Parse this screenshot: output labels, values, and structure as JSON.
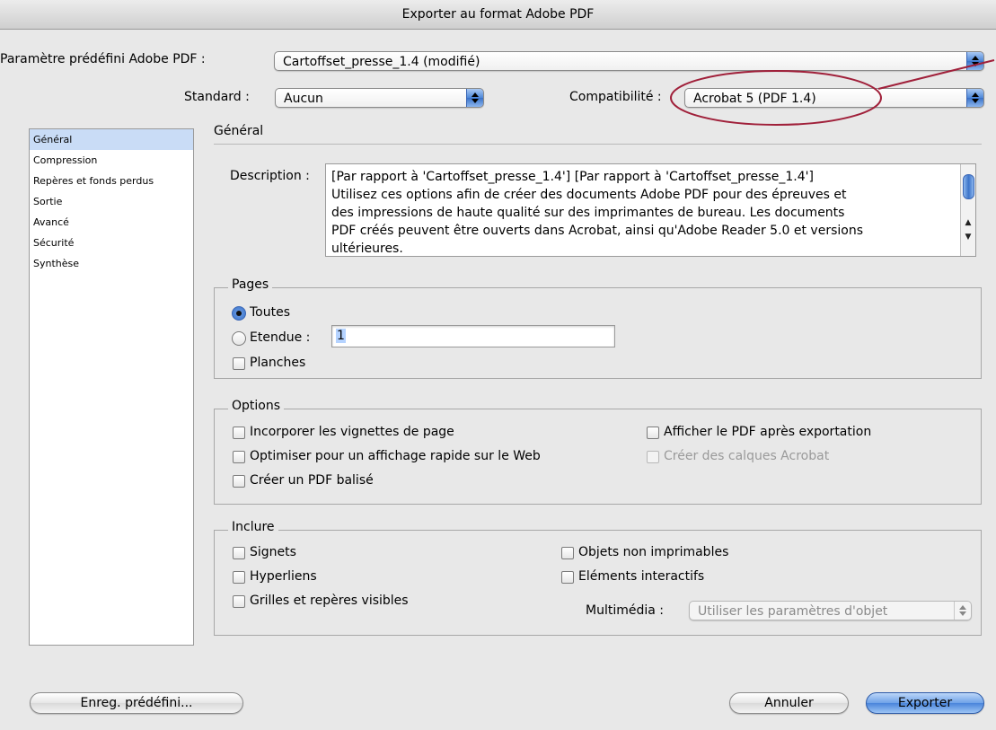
{
  "window": {
    "title": "Exporter au format Adobe PDF"
  },
  "preset": {
    "label": "Paramètre prédéfini Adobe PDF :",
    "value": "Cartoffset_presse_1.4 (modifié)"
  },
  "standard": {
    "label": "Standard :",
    "value": "Aucun"
  },
  "compatibility": {
    "label": "Compatibilité :",
    "value": "Acrobat 5 (PDF 1.4)"
  },
  "sidebar": {
    "items": [
      {
        "label": "Général",
        "selected": true
      },
      {
        "label": "Compression"
      },
      {
        "label": "Repères et fonds perdus"
      },
      {
        "label": "Sortie"
      },
      {
        "label": "Avancé"
      },
      {
        "label": "Sécurité"
      },
      {
        "label": "Synthèse"
      }
    ]
  },
  "general": {
    "title": "Général",
    "description_label": "Description :",
    "description_lines": [
      "[Par rapport à 'Cartoffset_presse_1.4'] [Par rapport à 'Cartoffset_presse_1.4']",
      "Utilisez ces options afin de créer des documents Adobe PDF pour des épreuves et",
      "des impressions de haute qualité sur des imprimantes de bureau. Les documents",
      "PDF créés peuvent être ouverts dans Acrobat, ainsi qu'Adobe Reader 5.0 et versions",
      "ultérieures."
    ]
  },
  "pages": {
    "title": "Pages",
    "all_label": "Toutes",
    "range_label": "Etendue :",
    "range_value": "1",
    "spreads_label": "Planches"
  },
  "options": {
    "title": "Options",
    "embed_thumbnails": "Incorporer les vignettes de page",
    "optimize_web": "Optimiser pour un affichage rapide sur le Web",
    "tagged_pdf": "Créer un PDF balisé",
    "view_after": "Afficher le PDF après exportation",
    "acrobat_layers": "Créer des calques Acrobat"
  },
  "include": {
    "title": "Inclure",
    "bookmarks": "Signets",
    "hyperlinks": "Hyperliens",
    "grids": "Grilles et repères visibles",
    "non_printing": "Objets non imprimables",
    "interactive": "Eléments interactifs",
    "multimedia_label": "Multimédia :",
    "multimedia_value": "Utiliser les paramètres d'objet"
  },
  "buttons": {
    "save_preset": "Enreg. prédéfini...",
    "cancel": "Annuler",
    "export": "Exporter"
  },
  "colors": {
    "annotation": "#a0203a",
    "selection": "#c9dcf6",
    "accent": "#3c74c9"
  }
}
